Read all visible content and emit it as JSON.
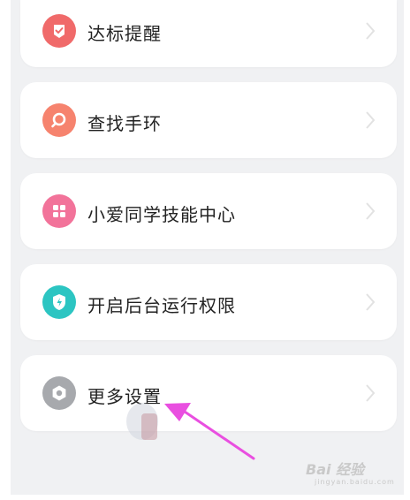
{
  "settings_list": [
    {
      "label": "达标提醒",
      "icon": "badge-check-icon",
      "color": "#f06a6a"
    },
    {
      "label": "查找手环",
      "icon": "search-icon",
      "color": "#f6836e"
    },
    {
      "label": "小爱同学技能中心",
      "icon": "grid-apps-icon",
      "color": "#f2739a"
    },
    {
      "label": "开启后台运行权限",
      "icon": "shield-bolt-icon",
      "color": "#2cc5c2"
    },
    {
      "label": "更多设置",
      "icon": "settings-gear-icon",
      "color": "#a7a9ad"
    }
  ],
  "annotation": {
    "arrow_color": "#e94fe0"
  },
  "watermark": {
    "main": "Bai 经验",
    "sub": "jingyan.baidu.com"
  }
}
